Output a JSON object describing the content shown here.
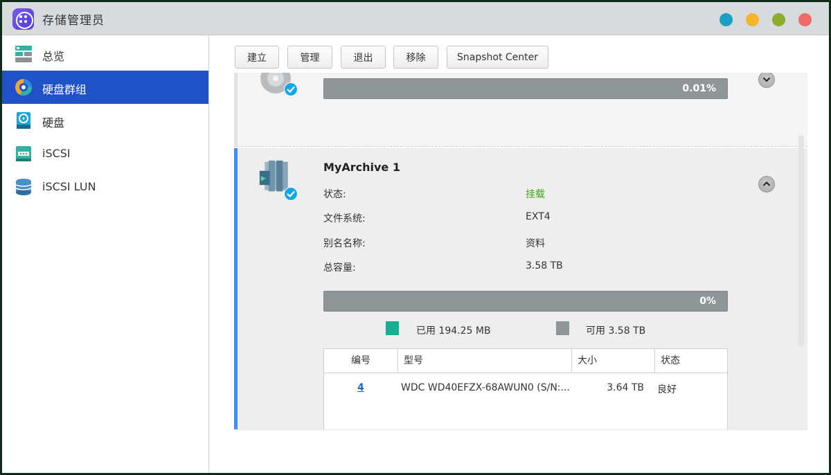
{
  "window": {
    "title": "存储管理员",
    "controls": [
      {
        "name": "info-button",
        "color": "#1aa0c3"
      },
      {
        "name": "minimize-button",
        "color": "#f4b62a"
      },
      {
        "name": "maximize-button",
        "color": "#8cac2a"
      },
      {
        "name": "close-button",
        "color": "#f16a6a"
      }
    ]
  },
  "sidebar": {
    "items": [
      {
        "label": "总览",
        "icon": "overview-icon",
        "active": false
      },
      {
        "label": "硬盘群组",
        "icon": "disk-group-icon",
        "active": true
      },
      {
        "label": "硬盘",
        "icon": "hard-disk-icon",
        "active": false
      },
      {
        "label": "iSCSI",
        "icon": "iscsi-icon",
        "active": false
      },
      {
        "label": "iSCSI LUN",
        "icon": "iscsi-lun-icon",
        "active": false
      }
    ]
  },
  "toolbar": {
    "create": "建立",
    "manage": "管理",
    "exit": "退出",
    "remove": "移除",
    "snapshot": "Snapshot Center"
  },
  "volumes": [
    {
      "name": "",
      "usage_percent_label": "0.01%",
      "usage_fraction": 0.0001,
      "expanded": false
    },
    {
      "name": "MyArchive 1",
      "expanded": true,
      "status_label": "状态:",
      "status_value": "挂载",
      "fs_label": "文件系统:",
      "fs_value": "EXT4",
      "alias_label": "别名名称:",
      "alias_value": "资料",
      "capacity_label": "总容量:",
      "capacity_value": "3.58 TB",
      "usage_percent_label": "0%",
      "usage_fraction": 0.0,
      "used_label": "已用 194.25 MB",
      "free_label": "可用 3.58 TB",
      "disk_table": {
        "headers": [
          "编号",
          "型号",
          "大小",
          "状态"
        ],
        "rows": [
          {
            "id": "4",
            "model": "WDC WD40EFZX-68AWUN0 (S/N:...",
            "size": "3.64 TB",
            "state": "良好"
          }
        ]
      }
    }
  ],
  "colors": {
    "accent": "#1f51c7",
    "selected_border": "#3d8ef5",
    "mounted_green": "#3aa614",
    "used_teal": "#14b090",
    "free_gray": "#8f969a",
    "link_blue": "#1a68c9"
  }
}
